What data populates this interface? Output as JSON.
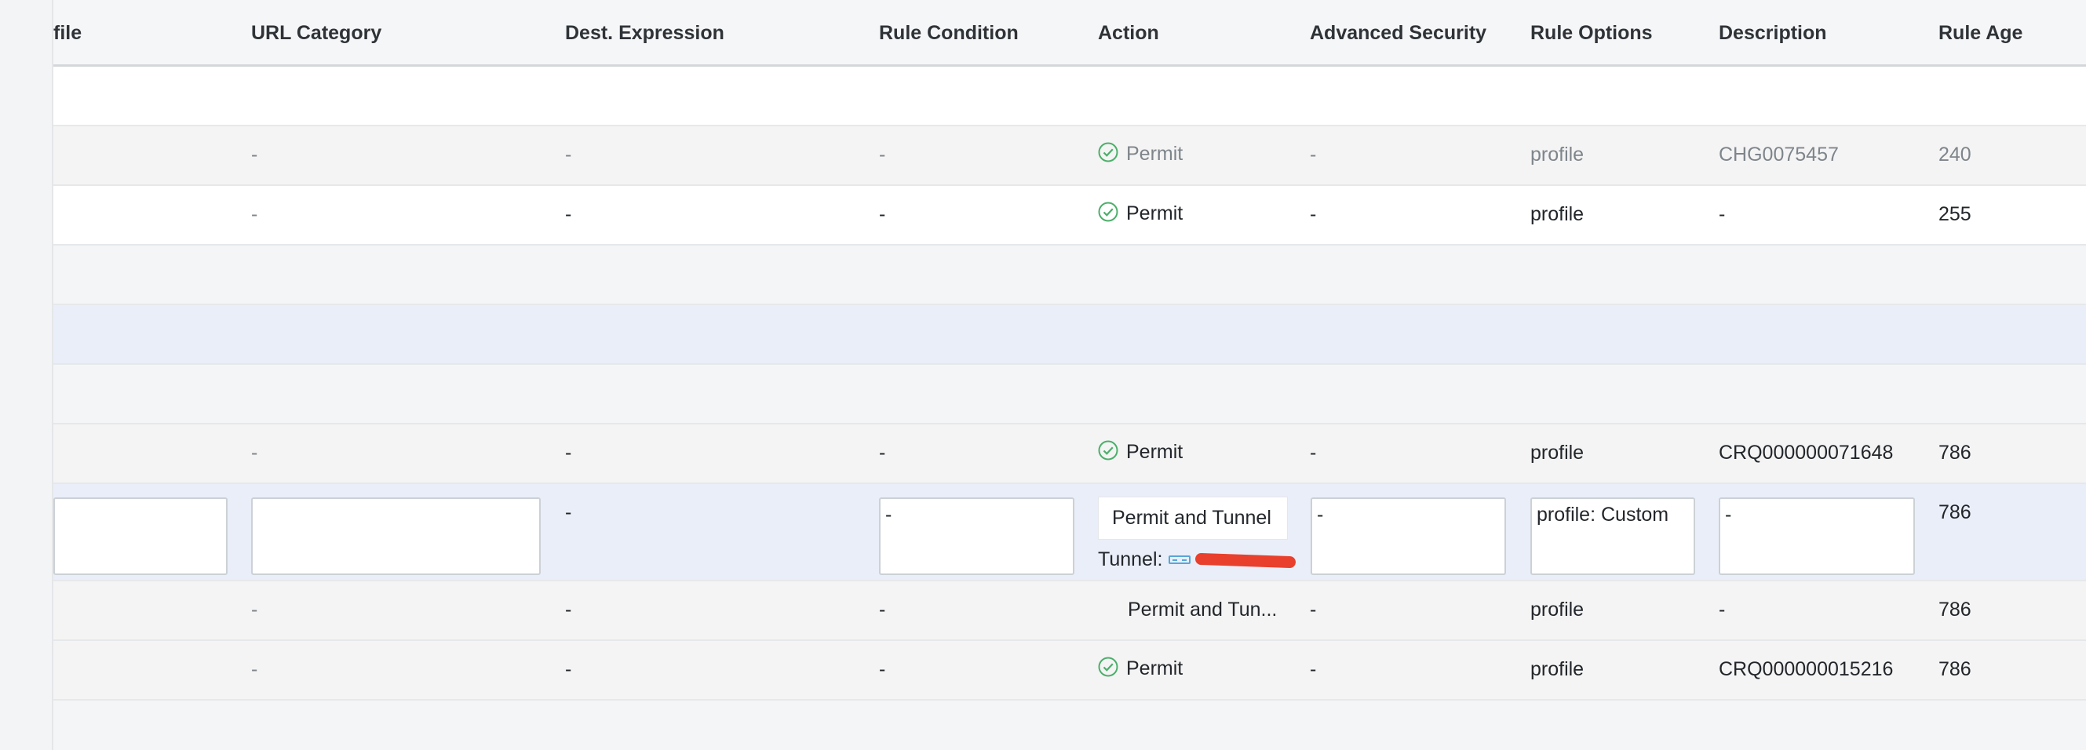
{
  "columns": {
    "profile": "file",
    "url_category": "URL Category",
    "dest_expression": "Dest. Expression",
    "rule_condition": "Rule Condition",
    "action": "Action",
    "advanced_security": "Advanced Security",
    "rule_options": "Rule Options",
    "description": "Description",
    "rule_age": "Rule Age"
  },
  "rows": [
    {
      "url_category": "-",
      "dest_expression": "-",
      "rule_condition": "-",
      "action": "Permit",
      "advanced_security": "-",
      "rule_options": "profile",
      "description": "CHG0075457",
      "rule_age": "240"
    },
    {
      "url_category": "-",
      "dest_expression": "-",
      "rule_condition": "-",
      "action": "Permit",
      "advanced_security": "-",
      "rule_options": "profile",
      "description": "-",
      "rule_age": "255"
    },
    {
      "url_category": "-",
      "dest_expression": "-",
      "rule_condition": "-",
      "action": "Permit",
      "advanced_security": "-",
      "rule_options": "profile",
      "description": "CRQ000000071648",
      "rule_age": "786"
    }
  ],
  "edit_row": {
    "dest_expression": "-",
    "rule_condition": "-",
    "action": "Permit and Tunnel",
    "tunnel_label": "Tunnel:",
    "advanced_security": "-",
    "rule_options": "profile: Custom",
    "description": "-",
    "rule_age": "786"
  },
  "rows_after": [
    {
      "url_category": "-",
      "dest_expression": "-",
      "rule_condition": "-",
      "action": "Permit and Tun...",
      "advanced_security": "-",
      "rule_options": "profile",
      "description": "-",
      "rule_age": "786"
    },
    {
      "url_category": "-",
      "dest_expression": "-",
      "rule_condition": "-",
      "action": "Permit",
      "advanced_security": "-",
      "rule_options": "profile",
      "description": "CRQ000000015216",
      "rule_age": "786"
    }
  ],
  "colors": {
    "permit_check": "#4caf6a",
    "selected_row": "#eaeef8",
    "redaction": "#e8402d"
  },
  "icons": {
    "permit": "check-circle-icon",
    "tunnel": "tunnel-icon"
  }
}
